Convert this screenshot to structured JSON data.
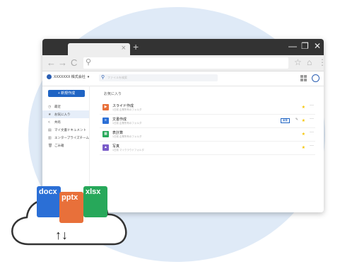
{
  "browser": {
    "tab_close": "×",
    "new_tab": "+",
    "window_controls": [
      "—",
      "❐",
      "✕"
    ],
    "nav": {
      "back": "←",
      "forward": "→",
      "reload": "C"
    },
    "address_icon": "search-icon"
  },
  "app": {
    "company_name": "XXXXXXX 株式会社",
    "company_caret": "▾",
    "search_placeholder": "ファイルを検索",
    "new_button": "+ 新規作成",
    "sidebar": [
      {
        "icon": "clock-icon",
        "glyph": "◷",
        "label": "最近"
      },
      {
        "icon": "star-icon",
        "glyph": "★",
        "label": "お気に入り",
        "active": true
      },
      {
        "icon": "share-icon",
        "glyph": "<",
        "label": "共有"
      },
      {
        "icon": "doc-icon",
        "glyph": "▤",
        "label": "マイ文書ドキュメント"
      },
      {
        "icon": "enterprise-icon",
        "glyph": "▥",
        "label": "エンタープライズチーム"
      },
      {
        "icon": "trash-icon",
        "glyph": "🗑",
        "label": "ごみ箱"
      }
    ],
    "section_title": "お気に入り",
    "files": [
      {
        "name": "スライド作成",
        "meta": "1日前 企業所有のフォルダ",
        "type": "slides",
        "color": "#e8703a",
        "glyph": "▶"
      },
      {
        "name": "文書作成",
        "meta": "1日前 企業所有のフォルダ",
        "type": "doc",
        "color": "#2b6fd6",
        "glyph": "≡",
        "badge": "編集"
      },
      {
        "name": "表計算",
        "meta": "1日前 企業所有のフォルダ",
        "type": "sheet",
        "color": "#27a85a",
        "glyph": "▦"
      },
      {
        "name": "写真",
        "meta": "1日前 マイクラウドフォルダ",
        "type": "photo",
        "color": "#7a5cc9",
        "glyph": "▲"
      }
    ],
    "star": "★",
    "more": "···"
  },
  "illustration": {
    "doc_labels": [
      "docx",
      "pptx",
      "xlsx"
    ],
    "doc_colors": [
      "#2b6fd6",
      "#e8703a",
      "#27a85a"
    ],
    "arrows": "↑↓"
  }
}
